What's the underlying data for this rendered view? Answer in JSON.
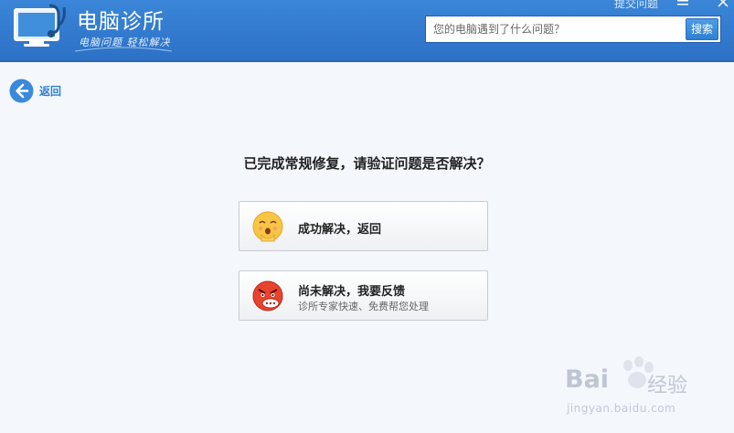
{
  "app": {
    "title": "电脑诊所",
    "slogan": "电脑问题 轻松解决"
  },
  "header": {
    "top_link": "提交问题",
    "search": {
      "placeholder": "您的电脑遇到了什么问题？",
      "button_label": "搜索"
    }
  },
  "nav": {
    "back_label": "返回"
  },
  "main": {
    "question": "已完成常规修复，请验证问题是否解决？",
    "options": [
      {
        "title": "成功解决，返回",
        "subtitle": "",
        "icon": "happy-face-icon"
      },
      {
        "title": "尚未解决，我要反馈",
        "subtitle": "诊所专家快速、免费帮您处理",
        "icon": "angry-face-icon"
      }
    ]
  },
  "watermark": {
    "brand": "Bai",
    "brand_cn": "经验",
    "url": "jingyan.baidu.com"
  },
  "colors": {
    "header_blue": "#2c71c6",
    "accent_blue": "#2d7fd4",
    "background": "#f4f7fc"
  }
}
